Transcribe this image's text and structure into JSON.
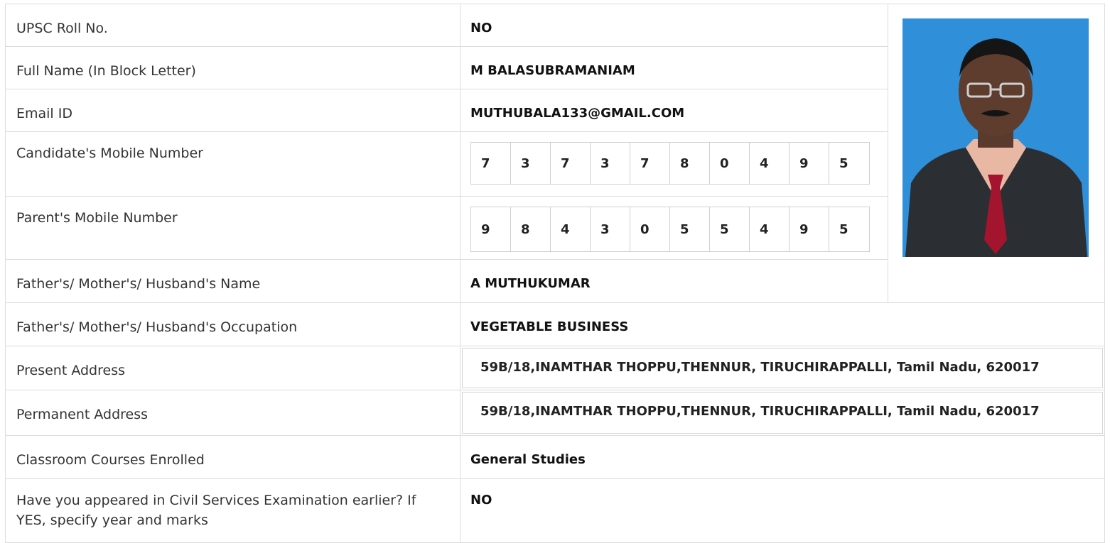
{
  "rows": [
    {
      "label": "UPSC Roll No.",
      "value": "NO"
    },
    {
      "label": "Full Name (In Block Letter)",
      "value": "M BALASUBRAMANIAM"
    },
    {
      "label": "Email ID",
      "value": "MUTHUBALA133@GMAIL.COM"
    },
    {
      "label": "Candidate's Mobile Number",
      "digits": [
        "7",
        "3",
        "7",
        "3",
        "7",
        "8",
        "0",
        "4",
        "9",
        "5"
      ]
    },
    {
      "label": "Parent's Mobile Number",
      "digits": [
        "9",
        "8",
        "4",
        "3",
        "0",
        "5",
        "5",
        "4",
        "9",
        "5"
      ]
    },
    {
      "label": "Father's/ Mother's/ Husband's Name",
      "value": "A MUTHUKUMAR"
    },
    {
      "label": "Father's/ Mother's/ Husband's Occupation",
      "value": "VEGETABLE BUSINESS"
    },
    {
      "label": "Present Address",
      "value": "59B/18,INAMTHAR THOPPU,THENNUR, TIRUCHIRAPPALLI, Tamil Nadu, 620017"
    },
    {
      "label": "Permanent Address",
      "value": "59B/18,INAMTHAR THOPPU,THENNUR, TIRUCHIRAPPALLI, Tamil Nadu, 620017"
    },
    {
      "label": "Classroom Courses Enrolled",
      "value": "General Studies"
    },
    {
      "label": "Have you appeared in Civil Services Examination earlier? If YES, specify year and marks",
      "value": "NO"
    }
  ],
  "colors": {
    "border": "#dcdcdc",
    "photo_bg": "#2e8fd6",
    "suit": "#2b2e33",
    "tie": "#a3152e",
    "shirt": "#e8b9a6"
  }
}
